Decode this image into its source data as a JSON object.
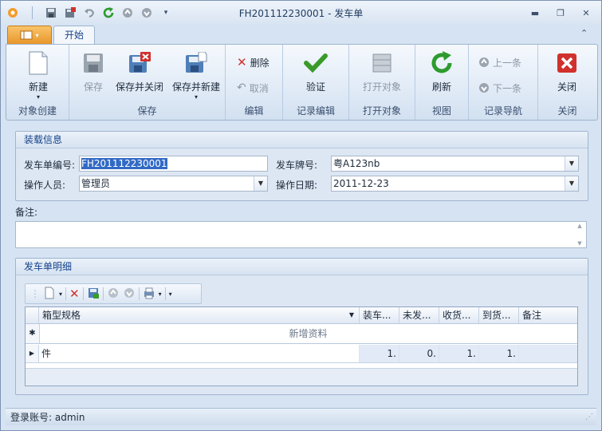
{
  "window": {
    "title": "FH201112230001 - 发车单"
  },
  "tabs": {
    "app_menu": "",
    "home": "开始"
  },
  "ribbon": {
    "new": "新建",
    "save": "保存",
    "save_close": "保存并关闭",
    "save_new": "保存并新建",
    "delete": "删除",
    "cancel": "取消",
    "validate": "验证",
    "open_object": "打开对象",
    "refresh": "刷新",
    "prev": "上一条",
    "next": "下一条",
    "close": "关闭",
    "groups": [
      "对象创建",
      "保存",
      "编辑",
      "记录编辑",
      "打开对象",
      "视图",
      "记录导航",
      "关闭"
    ]
  },
  "load_info": {
    "title": "装载信息",
    "order_no_label": "发车单编号:",
    "order_no": "FH201112230001",
    "plate_label": "发车牌号:",
    "plate": "粤A123nb",
    "operator_label": "操作人员:",
    "operator": "管理员",
    "date_label": "操作日期:",
    "date": "2011-12-23"
  },
  "remark": {
    "label": "备注:",
    "value": ""
  },
  "detail": {
    "title": "发车单明细",
    "columns": [
      "箱型规格",
      "装车...",
      "未发...",
      "收货...",
      "到货...",
      "备注"
    ],
    "new_row": "新增资料",
    "rows": [
      {
        "spec": "件",
        "load": "1.",
        "unsent": "0.",
        "recv": "1.",
        "arrive": "1.",
        "note": ""
      }
    ]
  },
  "status": {
    "text": "登录账号: admin"
  }
}
